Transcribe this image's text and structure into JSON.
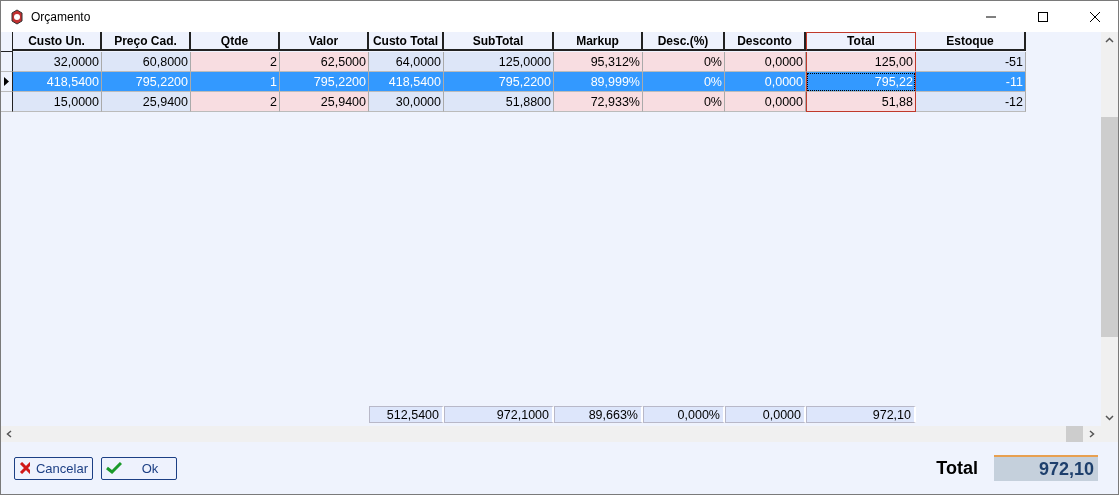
{
  "window": {
    "title": "Orçamento"
  },
  "columns": [
    {
      "label": "Custo Un.",
      "kind": "calc",
      "highlighted": false
    },
    {
      "label": "Preço Cad.",
      "kind": "calc",
      "highlighted": false
    },
    {
      "label": "Qtde",
      "kind": "input",
      "highlighted": false
    },
    {
      "label": "Valor",
      "kind": "input",
      "highlighted": false
    },
    {
      "label": "Custo Total",
      "kind": "calc",
      "highlighted": false,
      "total": "512,5400"
    },
    {
      "label": "SubTotal",
      "kind": "calc",
      "highlighted": false,
      "total": "972,1000"
    },
    {
      "label": "Markup",
      "kind": "input",
      "highlighted": false,
      "total": "89,663%"
    },
    {
      "label": "Desc.(%)",
      "kind": "input",
      "highlighted": false,
      "total": "0,000%"
    },
    {
      "label": "Desconto",
      "kind": "input",
      "highlighted": false,
      "total": "0,0000"
    },
    {
      "label": "Total",
      "kind": "input",
      "highlighted": true,
      "total": "972,10"
    },
    {
      "label": "Estoque",
      "kind": "calc",
      "highlighted": false
    }
  ],
  "rows": [
    {
      "selected": false,
      "cells": [
        "32,0000",
        "60,8000",
        "2",
        "62,5000",
        "64,0000",
        "125,0000",
        "95,312%",
        "0%",
        "0,0000",
        "125,00",
        "-51"
      ]
    },
    {
      "selected": true,
      "cells": [
        "418,5400",
        "795,2200",
        "1",
        "795,2200",
        "418,5400",
        "795,2200",
        "89,999%",
        "0%",
        "0,0000",
        "795,22",
        "-11"
      ]
    },
    {
      "selected": false,
      "cells": [
        "15,0000",
        "25,9400",
        "2",
        "25,9400",
        "30,0000",
        "51,8800",
        "72,933%",
        "0%",
        "0,0000",
        "51,88",
        "-12"
      ]
    }
  ],
  "buttons": [
    {
      "label": "Cancelar",
      "kind": "cancel"
    },
    {
      "label": "Ok",
      "kind": "ok"
    }
  ],
  "grand_total": {
    "label": "Total",
    "value": "972,10"
  }
}
